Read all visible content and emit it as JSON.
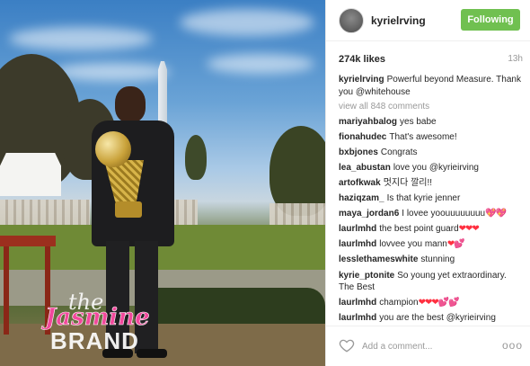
{
  "post": {
    "username": "kyrielrving",
    "follow_label": "Following",
    "likes": "274k likes",
    "time": "13h",
    "caption": {
      "user": "kyrielrving",
      "text": "Powerful beyond Measure. Thank you @whitehouse"
    },
    "view_all": "view all 848 comments"
  },
  "comments": [
    {
      "user": "mariyahbalog",
      "text": "yes babe"
    },
    {
      "user": "fionahudec",
      "text": "That's awesome!"
    },
    {
      "user": "bxbjones",
      "text": "Congrats"
    },
    {
      "user": "lea_abustan",
      "text": "love you @kyrieirving"
    },
    {
      "user": "artofkwak",
      "text": "멋지다 깔리!!"
    },
    {
      "user": "haziqzam_",
      "text": "Is that kyrie jenner"
    },
    {
      "user": "maya_jordan6",
      "text": "I lovee yoouuuuuuuu",
      "emoji": "💖💖"
    },
    {
      "user": "laurlmhd",
      "text": "the best point guard",
      "emoji": "❤❤❤"
    },
    {
      "user": "laurlmhd",
      "text": "lovvee you mann",
      "emoji": "❤💕"
    },
    {
      "user": "lesslethameswhite",
      "text": "stunning"
    },
    {
      "user": "kyrie_ptonite",
      "text": "So young yet extraordinary. The Best"
    },
    {
      "user": "laurlmhd",
      "text": "champion",
      "emoji": "❤❤❤💕💕"
    },
    {
      "user": "laurlmhd",
      "text": "you are the best @kyrieirving"
    }
  ],
  "add_comment": {
    "placeholder": "Add a comment...",
    "more": "ooo"
  },
  "watermark": {
    "line1": "the",
    "line2": "Jasmine",
    "line3": "BRAND"
  },
  "colors": {
    "follow_button": "#70c050",
    "heart_emoji": "#ff3040"
  }
}
